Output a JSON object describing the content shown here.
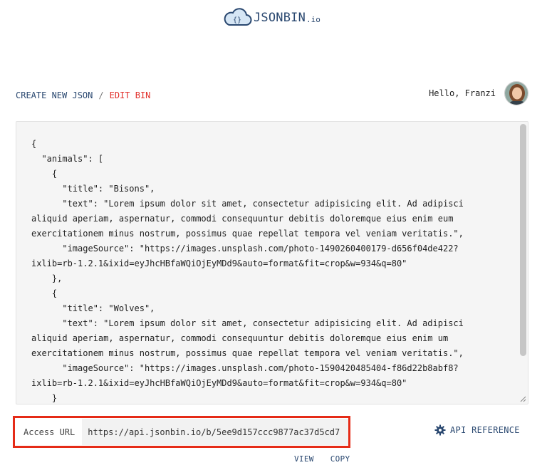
{
  "header": {
    "logo_text": "JSONBIN",
    "logo_tld": ".io",
    "logo_icon": "cloud-braces-icon"
  },
  "breadcrumb": {
    "create": "CREATE NEW JSON",
    "separator": "/",
    "current": "EDIT BIN"
  },
  "user": {
    "greeting": "Hello, Franzi",
    "avatar_icon": "user-avatar"
  },
  "editor": {
    "lines": [
      "{",
      "  \"animals\": [",
      "    {",
      "      \"title\": \"Bisons\",",
      "      \"text\": \"Lorem ipsum dolor sit amet, consectetur adipisicing elit. Ad adipisci",
      "aliquid aperiam, aspernatur, commodi consequuntur debitis doloremque eius enim eum",
      "exercitationem minus nostrum, possimus quae repellat tempora vel veniam veritatis.\",",
      "      \"imageSource\": \"https://images.unsplash.com/photo-1490260400179-d656f04de422?",
      "ixlib=rb-1.2.1&ixid=eyJhcHBfaWQiOjEyMDd9&auto=format&fit=crop&w=934&q=80\"",
      "    },",
      "    {",
      "      \"title\": \"Wolves\",",
      "      \"text\": \"Lorem ipsum dolor sit amet, consectetur adipisicing elit. Ad adipisci",
      "aliquid aperiam, aspernatur, commodi consequuntur debitis doloremque eius enim um",
      "exercitationem minus nostrum, possimus quae repellat tempora vel veniam veritatis.\",",
      "      \"imageSource\": \"https://images.unsplash.com/photo-1590420485404-f86d22b8abf8?",
      "ixlib=rb-1.2.1&ixid=eyJhcHBfaWQiOjEyMDd9&auto=format&fit=crop&w=934&q=80\"",
      "    }"
    ]
  },
  "access": {
    "label": "Access URL",
    "url": "https://api.jsonbin.io/b/5ee9d157ccc9877ac37d5cd7",
    "highlight_color": "#e52b17"
  },
  "api_reference": {
    "label": "API REFERENCE",
    "icon": "gear-icon"
  },
  "actions": {
    "view": "VIEW",
    "copy": "COPY"
  },
  "colors": {
    "brand": "#2a4870",
    "accent_red": "#e2302b"
  }
}
